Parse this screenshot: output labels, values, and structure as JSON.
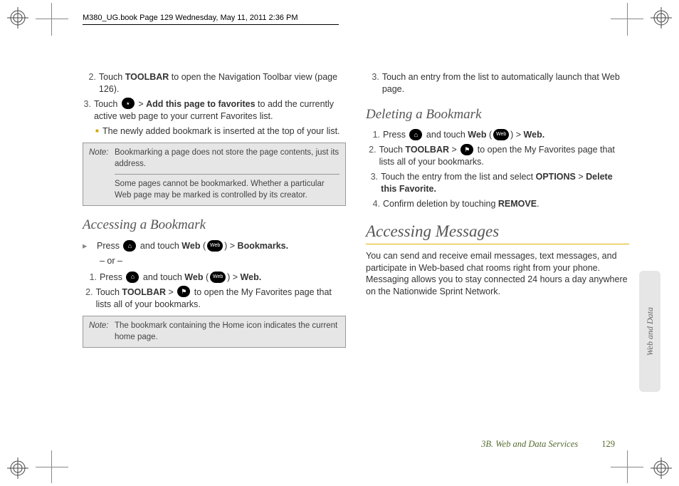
{
  "pageHeader": "M380_UG.book  Page 129  Wednesday, May 11, 2011  2:36 PM",
  "col1": {
    "step2": {
      "n": "2.",
      "a": "Touch ",
      "b": "TOOLBAR",
      "c": " to open the Navigation Toolbar view (page 126)."
    },
    "step3": {
      "n": "3.",
      "a": "Touch ",
      "b": "Add this page to favorites",
      "c": " to add the currently active web page to your current Favorites list.",
      "gt": ">"
    },
    "sub": "The newly added bookmark is inserted at the top of your list.",
    "noteLbl": "Note:",
    "note1": "Bookmarking a page does not store the page contents, just its address.",
    "note2": "Some pages cannot be bookmarked. Whether a particular Web page may be marked is controlled by its creator.",
    "h1": "Accessing a Bookmark",
    "arrow": {
      "a": "Press ",
      "b": " and touch ",
      "web": "Web",
      "p1": " (",
      "p2": ") ",
      "gt": ">",
      "bm": "Bookmarks."
    },
    "or": "– or –",
    "a1": {
      "n": "1.",
      "a": "Press ",
      "b": " and touch ",
      "web": "Web",
      "p1": " (",
      "p2": ") ",
      "gt": ">",
      "w2": "Web."
    },
    "a2": {
      "n": "2.",
      "a": "Touch ",
      "b": "TOOLBAR",
      "gt": " > ",
      "c": " to open the My Favorites page that lists all of your bookmarks."
    },
    "note3": "The bookmark containing the Home icon indicates the current home page."
  },
  "col2": {
    "step3": {
      "n": "3.",
      "t": "Touch an entry from the list to automatically launch that Web page."
    },
    "h1": "Deleting a Bookmark",
    "d1": {
      "n": "1.",
      "a": "Press ",
      "b": " and touch ",
      "web": "Web",
      "p1": " (",
      "p2": ") ",
      "gt": ">",
      "w2": "Web."
    },
    "d2": {
      "n": "2.",
      "a": "Touch ",
      "b": "TOOLBAR",
      "gt": " > ",
      "c": " to open the My Favorites page that lists all of your bookmarks."
    },
    "d3": {
      "n": "3.",
      "a": "Touch the entry from the list and select ",
      "b": "OPTIONS",
      "gt": " > ",
      "c": "Delete this Favorite."
    },
    "d4": {
      "n": "4.",
      "a": "Confirm deletion by touching ",
      "b": "REMOVE",
      "c": "."
    },
    "h2": "Accessing Messages",
    "body": "You can send and receive email messages, text messages, and participate in Web-based chat rooms right from your phone. Messaging allows you to stay connected 24 hours a day anywhere on the Nationwide Sprint Network."
  },
  "footer": {
    "section": "3B. Web and Data Services",
    "page": "129"
  },
  "sideTab": "Web and Data",
  "icons": {
    "fav": "⭑",
    "home": "⌂",
    "web": "Web",
    "flag": "⚑"
  }
}
